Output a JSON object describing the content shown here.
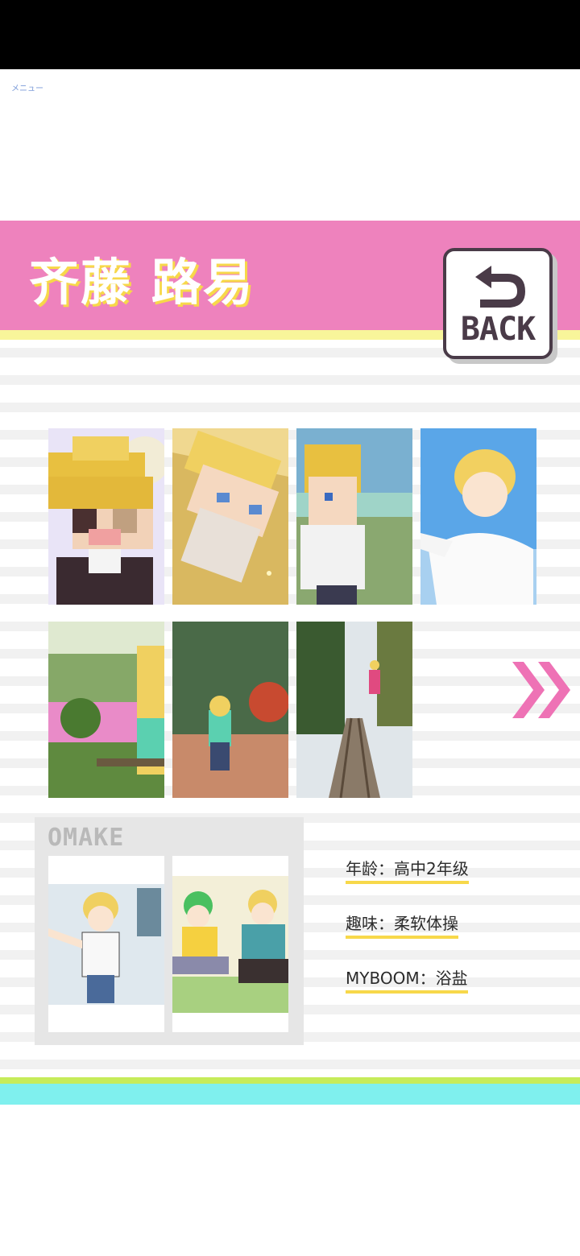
{
  "menu": {
    "label": "メニュー"
  },
  "header": {
    "name": "齐藤 路易",
    "back_label": "BACK"
  },
  "gallery": {
    "tiles": [
      {
        "icon": "pixel-face-closeup-image"
      },
      {
        "icon": "pixel-character-lying-image"
      },
      {
        "icon": "pixel-character-park-image"
      },
      {
        "icon": "anime-character-sky-image"
      },
      {
        "icon": "flower-field-photo-image"
      },
      {
        "icon": "park-path-photo-image"
      },
      {
        "icon": "railway-track-photo-image"
      }
    ],
    "next_icon": "double-chevron-right-icon"
  },
  "omake": {
    "title": "OMAKE",
    "tiles": [
      {
        "icon": "character-selfie-image"
      },
      {
        "icon": "two-characters-gaming-image"
      }
    ]
  },
  "profile": {
    "age": {
      "label": "年龄",
      "sep": "：",
      "value": "高中2年级"
    },
    "hobby": {
      "label": "趣味",
      "sep": "：",
      "value": "柔软体操"
    },
    "myboom": {
      "label": "MYBOOM",
      "sep": "：",
      "value": "浴盐"
    }
  },
  "colors": {
    "header_pink": "#ee82bd",
    "accent_yellow": "#f7d84a",
    "footer_green": "#c6ec5a",
    "footer_cyan": "#7ff0ee"
  }
}
